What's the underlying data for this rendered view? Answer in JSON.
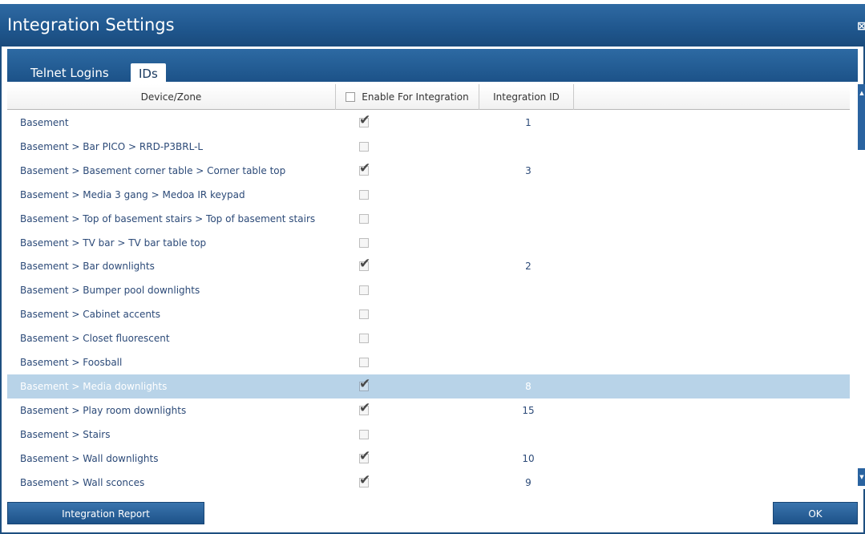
{
  "window": {
    "title": "Integration Settings",
    "close_icon": "close-icon"
  },
  "tabs": [
    {
      "label": "Telnet Logins",
      "active": false
    },
    {
      "label": "IDs",
      "active": true
    }
  ],
  "grid": {
    "columns": {
      "device": "Device/Zone",
      "enable": "Enable For Integration",
      "id": "Integration ID"
    },
    "rows": [
      {
        "name": "Basement",
        "enabled": true,
        "id": "1",
        "selected": false
      },
      {
        "name": "Basement > Bar PICO > RRD-P3BRL-L",
        "enabled": false,
        "id": "",
        "selected": false
      },
      {
        "name": "Basement > Basement corner table > Corner table top",
        "enabled": true,
        "id": "3",
        "selected": false
      },
      {
        "name": "Basement > Media 3 gang > Medoa IR keypad",
        "enabled": false,
        "id": "",
        "selected": false
      },
      {
        "name": "Basement > Top of basement stairs > Top of basement stairs",
        "enabled": false,
        "id": "",
        "selected": false
      },
      {
        "name": "Basement > TV bar > TV bar table top",
        "enabled": false,
        "id": "",
        "selected": false
      },
      {
        "name": "Basement > Bar downlights",
        "enabled": true,
        "id": "2",
        "selected": false
      },
      {
        "name": "Basement > Bumper pool downlights",
        "enabled": false,
        "id": "",
        "selected": false
      },
      {
        "name": "Basement > Cabinet accents",
        "enabled": false,
        "id": "",
        "selected": false
      },
      {
        "name": "Basement > Closet fluorescent",
        "enabled": false,
        "id": "",
        "selected": false
      },
      {
        "name": "Basement > Foosball",
        "enabled": false,
        "id": "",
        "selected": false
      },
      {
        "name": "Basement > Media downlights",
        "enabled": true,
        "id": "8",
        "selected": true
      },
      {
        "name": "Basement > Play room downlights",
        "enabled": true,
        "id": "15",
        "selected": false
      },
      {
        "name": "Basement > Stairs",
        "enabled": false,
        "id": "",
        "selected": false
      },
      {
        "name": "Basement > Wall downlights",
        "enabled": true,
        "id": "10",
        "selected": false
      },
      {
        "name": "Basement > Wall sconces",
        "enabled": true,
        "id": "9",
        "selected": false
      }
    ]
  },
  "buttons": {
    "report": "Integration Report",
    "ok": "OK"
  },
  "colors": {
    "accent": "#1f568d",
    "selected_row": "#b8d3e8"
  }
}
